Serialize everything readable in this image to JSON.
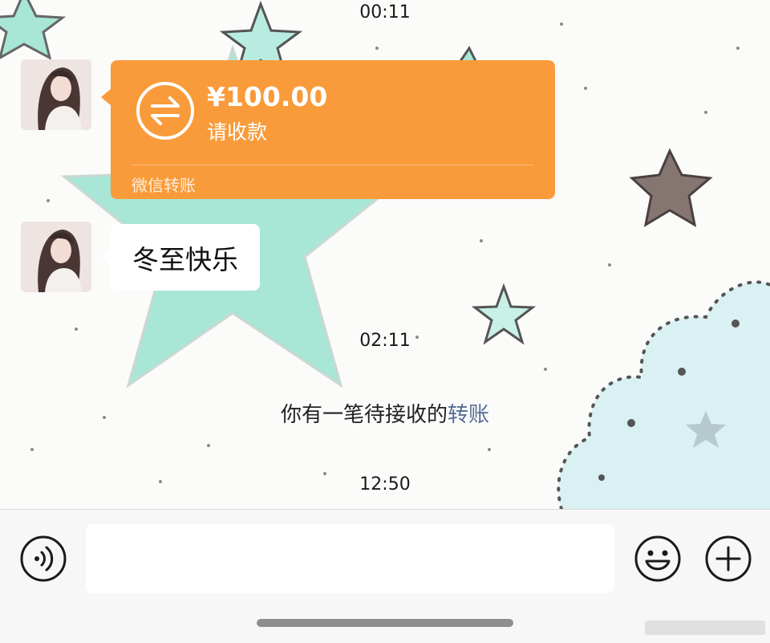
{
  "chat": {
    "timestamps": [
      "00:11",
      "02:11",
      "12:50"
    ],
    "transfer": {
      "amount": "¥100.00",
      "status": "请收款",
      "source": "微信转账",
      "card_color": "#f99b3a"
    },
    "text_message": "冬至快乐",
    "system_message": {
      "prefix": "你有一笔待接收的",
      "link": "转账",
      "link_color": "#576b95"
    }
  },
  "input_bar": {
    "placeholder": "",
    "value": ""
  },
  "icons": {
    "transfer": "transfer-arrows-icon",
    "voice": "voice-icon",
    "emoji": "emoji-icon",
    "plus": "plus-icon"
  }
}
